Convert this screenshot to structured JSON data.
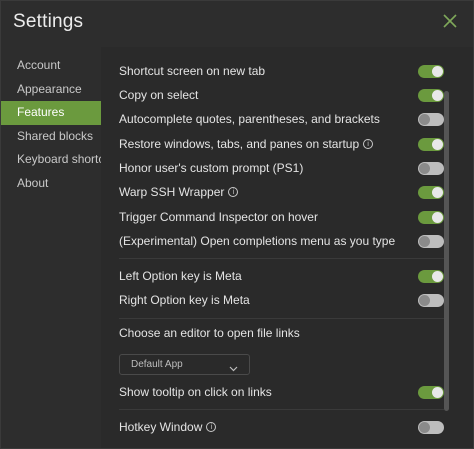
{
  "window": {
    "title": "Settings"
  },
  "sidebar": {
    "items": [
      {
        "label": "Account"
      },
      {
        "label": "Appearance"
      },
      {
        "label": "Features",
        "active": true
      },
      {
        "label": "Shared blocks"
      },
      {
        "label": "Keyboard shortcuts"
      },
      {
        "label": "About"
      }
    ]
  },
  "features": {
    "shortcut_screen": {
      "label": "Shortcut screen on new tab",
      "on": true
    },
    "copy_on_select": {
      "label": "Copy on select",
      "on": true
    },
    "autocomplete": {
      "label": "Autocomplete quotes, parentheses, and brackets",
      "on": false
    },
    "restore_windows": {
      "label": "Restore windows, tabs, and panes on startup",
      "on": true
    },
    "honor_prompt": {
      "label": "Honor user's custom prompt (PS1)",
      "on": false
    },
    "warp_ssh": {
      "label": "Warp SSH Wrapper",
      "on": true
    },
    "trigger_inspector": {
      "label": "Trigger Command Inspector on hover",
      "on": true
    },
    "experimental_completions": {
      "label": "(Experimental) Open completions menu as you type",
      "on": false
    },
    "left_option_meta": {
      "label": "Left Option key is Meta",
      "on": true
    },
    "right_option_meta": {
      "label": "Right Option key is Meta",
      "on": false
    },
    "editor_heading": "Choose an editor to open file links",
    "editor_select_value": "Default App",
    "show_tooltip": {
      "label": "Show tooltip on click on links",
      "on": true
    },
    "hotkey_window": {
      "label": "Hotkey Window",
      "on": false
    }
  },
  "colors": {
    "accent": "#6b9a3e",
    "background": "#2d2d2d"
  },
  "icons": {
    "close": "close-icon",
    "info": "info-icon",
    "chevron": "chevron-down-icon"
  }
}
